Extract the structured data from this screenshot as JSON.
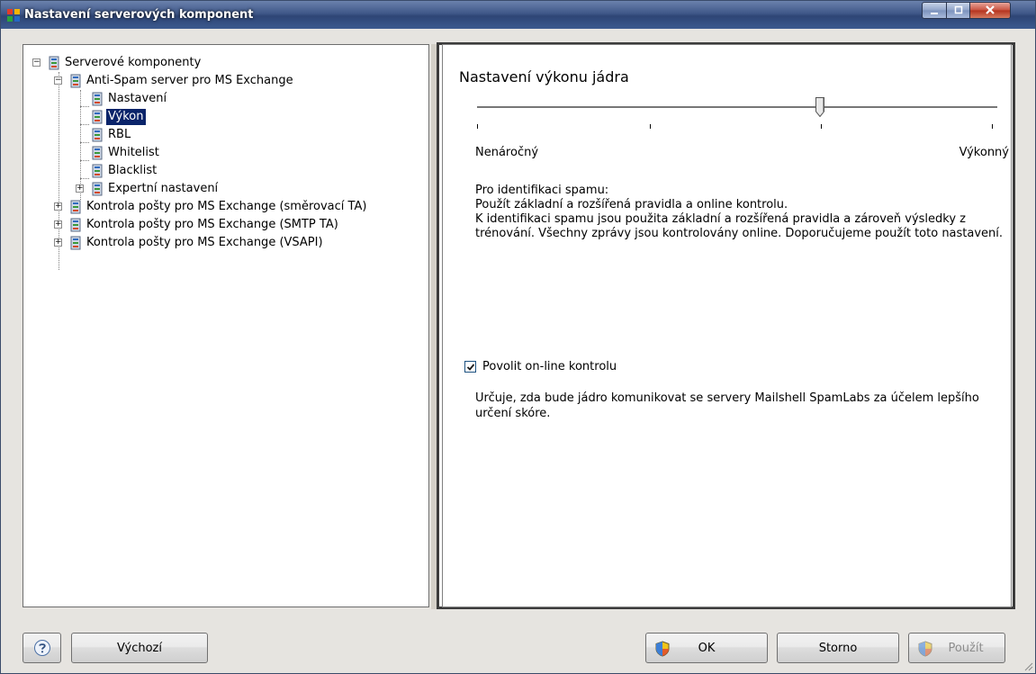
{
  "window": {
    "title": "Nastavení serverových komponent"
  },
  "tree": {
    "items": [
      {
        "label": "Serverové komponenty",
        "expander": "−"
      },
      {
        "label": "Anti-Spam server pro MS Exchange",
        "expander": "−"
      },
      {
        "label": "Nastavení"
      },
      {
        "label": "Výkon",
        "selected": true
      },
      {
        "label": "RBL"
      },
      {
        "label": "Whitelist"
      },
      {
        "label": "Blacklist"
      },
      {
        "label": "Expertní nastavení",
        "expander": "+"
      },
      {
        "label": "Kontrola pošty pro MS Exchange (směrovací TA)",
        "expander": "+"
      },
      {
        "label": "Kontrola pošty pro MS Exchange (SMTP TA)",
        "expander": "+"
      },
      {
        "label": "Kontrola pošty pro MS Exchange (VSAPI)",
        "expander": "+"
      }
    ]
  },
  "panel": {
    "heading": "Nastavení výkonu jádra",
    "slider": {
      "min_label": "Nenáročný",
      "max_label": "Výkonný",
      "positions": 4,
      "selected_index": 2
    },
    "description": {
      "line1": "Pro identifikaci spamu:",
      "line2": "Použít základní a rozšířená pravidla a online kontrolu.",
      "line3": "K identifikaci spamu jsou použita základní a rozšířená pravidla a zároveň výsledky z trénování. Všechny zprávy jsou kontrolovány online. Doporučujeme použít toto nastavení."
    },
    "online_check": {
      "label": "Povolit on-line kontrolu",
      "checked": true
    },
    "online_note": "Určuje, zda bude jádro komunikovat se servery Mailshell SpamLabs za účelem lepšího určení skóre."
  },
  "buttons": {
    "help": "help-icon",
    "default_label": "Výchozí",
    "ok_label": "OK",
    "cancel_label": "Storno",
    "apply_label": "Použít"
  },
  "colors": {
    "selection": "#0a246a",
    "titlebar": "#3f5788"
  }
}
